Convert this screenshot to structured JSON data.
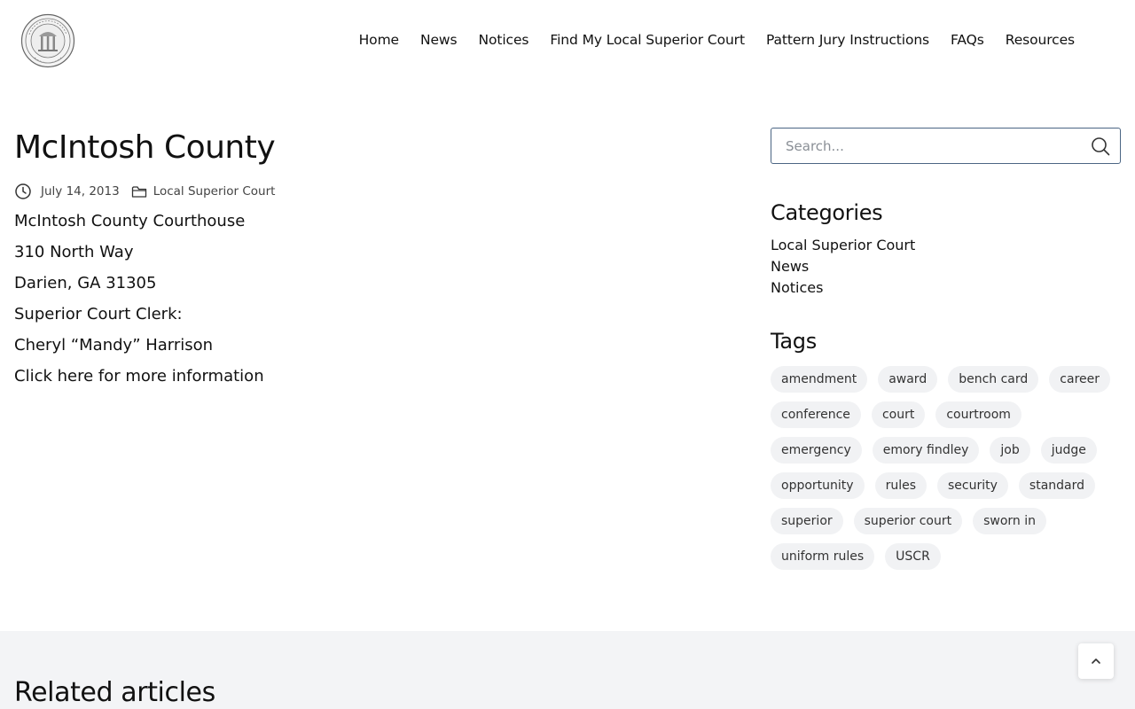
{
  "nav": {
    "items": [
      {
        "label": "Home"
      },
      {
        "label": "News"
      },
      {
        "label": "Notices"
      },
      {
        "label": "Find My Local Superior Court"
      },
      {
        "label": "Pattern Jury Instructions"
      },
      {
        "label": "FAQs"
      },
      {
        "label": "Resources"
      }
    ]
  },
  "article": {
    "title": "McIntosh County",
    "date": "July 14, 2013",
    "category": "Local Superior Court",
    "lines": [
      "McIntosh County Courthouse",
      "310 North Way",
      "Darien, GA 31305",
      "Superior Court Clerk:",
      "Cheryl “Mandy” Harrison"
    ],
    "link_text": "Click here for more information"
  },
  "sidebar": {
    "search_placeholder": "Search...",
    "categories_heading": "Categories",
    "categories": [
      "Local Superior Court",
      "News",
      "Notices"
    ],
    "tags_heading": "Tags",
    "tags": [
      "amendment",
      "award",
      "bench card",
      "career",
      "conference",
      "court",
      "courtroom",
      "emergency",
      "emory findley",
      "job",
      "judge",
      "opportunity",
      "rules",
      "security",
      "standard",
      "superior",
      "superior court",
      "sworn in",
      "uniform rules",
      "USCR"
    ]
  },
  "related": {
    "title": "Related articles"
  },
  "icons": {
    "logo": "state-of-georgia-seal",
    "date": "clock-icon",
    "category": "folder-icon",
    "search": "search-icon",
    "to_top": "chevron-up-icon"
  }
}
